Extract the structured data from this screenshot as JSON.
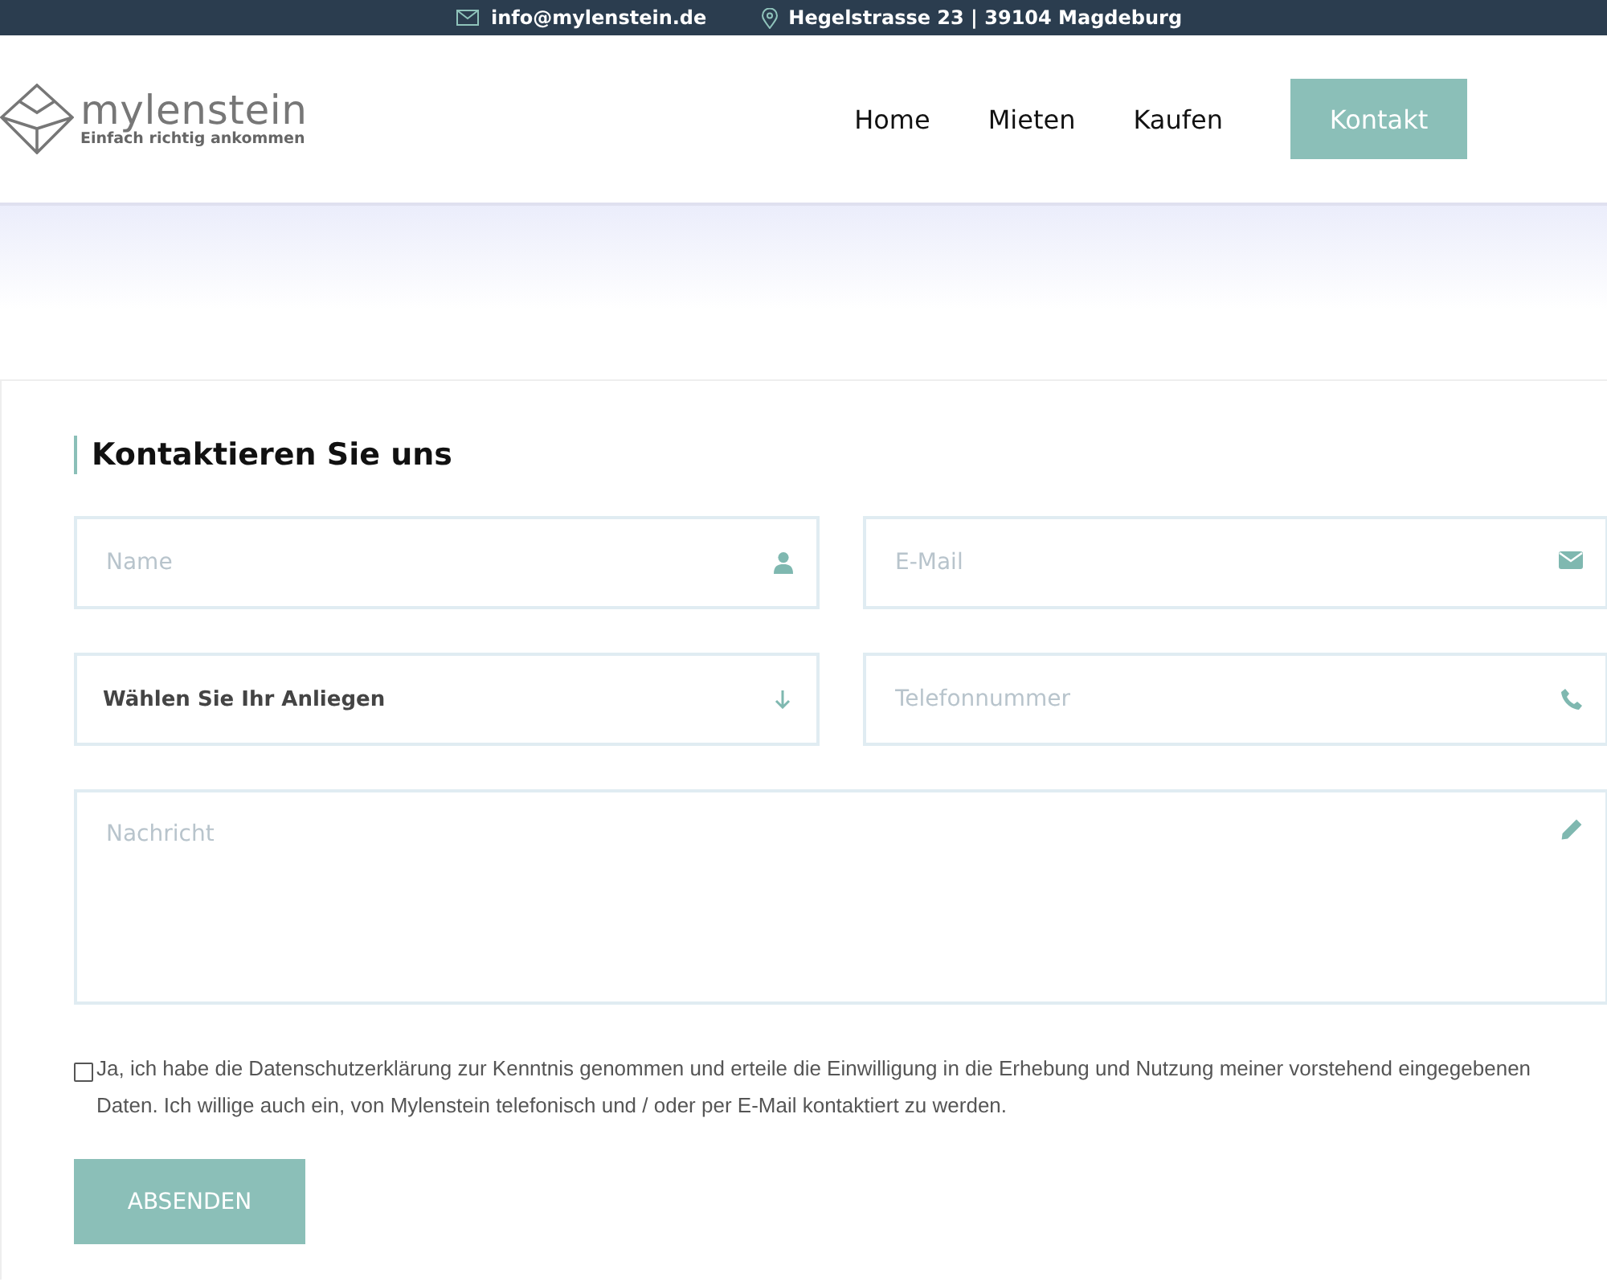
{
  "top_bar": {
    "email": "info@mylenstein.de",
    "address": "Hegelstrasse 23 | 39104 Magdeburg"
  },
  "logo": {
    "name": "mylenstein",
    "tagline": "Einfach richtig ankommen"
  },
  "nav": [
    {
      "label": "Home",
      "kind": "link"
    },
    {
      "label": "Mieten",
      "kind": "link"
    },
    {
      "label": "Kaufen",
      "kind": "link"
    },
    {
      "label": "Kontakt",
      "kind": "button"
    }
  ],
  "form": {
    "title": "Kontaktieren Sie uns",
    "fields": [
      {
        "kind": "name",
        "placeholder": "Name"
      },
      {
        "kind": "email",
        "placeholder": "E-Mail"
      },
      {
        "kind": "select",
        "value": "Wählen Sie Ihr Anliegen"
      },
      {
        "kind": "phone",
        "placeholder": "Telefonnummer"
      },
      {
        "kind": "message",
        "placeholder": "Nachricht"
      }
    ],
    "consent": {
      "checked": false,
      "text": "Ja, ich habe die Datenschutzerklärung zur Kenntnis genommen und erteile die Einwilligung in die Erhebung und Nutzung meiner vorstehend eingegebenen Daten. Ich willige auch ein, von Mylenstein telefonisch und / oder per E-Mail kontaktiert zu werden."
    },
    "submit": "ABSENDEN"
  }
}
